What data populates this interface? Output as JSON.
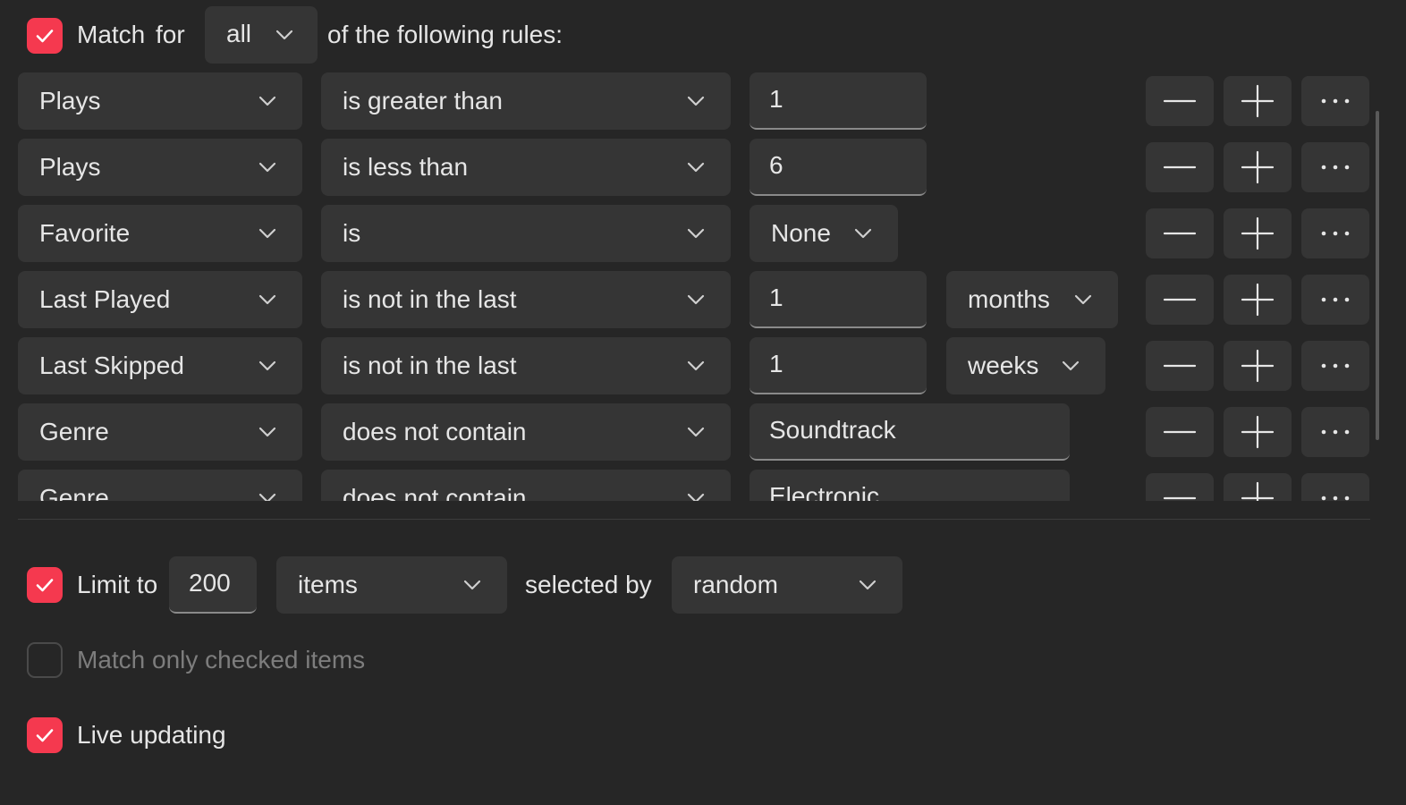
{
  "header": {
    "match_checked": true,
    "match_label": "Match",
    "for_label": "for",
    "quantifier": "all",
    "suffix": "of the following rules:"
  },
  "rules": [
    {
      "field": "Plays",
      "operator": "is greater than",
      "value": "1",
      "unit": null
    },
    {
      "field": "Plays",
      "operator": "is less than",
      "value": "6",
      "unit": null
    },
    {
      "field": "Favorite",
      "operator": "is",
      "value": "None",
      "unit": null
    },
    {
      "field": "Last Played",
      "operator": "is not in the last",
      "value": "1",
      "unit": "months"
    },
    {
      "field": "Last Skipped",
      "operator": "is not in the last",
      "value": "1",
      "unit": "weeks"
    },
    {
      "field": "Genre",
      "operator": "does not contain",
      "value": "Soundtrack",
      "unit": null
    },
    {
      "field": "Genre",
      "operator": "does not contain",
      "value": "Electronic",
      "unit": null
    }
  ],
  "rule_buttons": {
    "remove_icon": "minus-icon",
    "add_icon": "plus-icon",
    "more_icon": "ellipsis-icon"
  },
  "limit": {
    "checked": true,
    "label": "Limit to",
    "value": "200",
    "unit": "items",
    "selected_by_label": "selected by",
    "selected_by": "random"
  },
  "match_only_checked": {
    "checked": false,
    "label": "Match only checked items"
  },
  "live_updating": {
    "checked": true,
    "label": "Live updating"
  },
  "colors": {
    "accent": "#f5394f",
    "background": "#262626",
    "control": "#353535"
  }
}
